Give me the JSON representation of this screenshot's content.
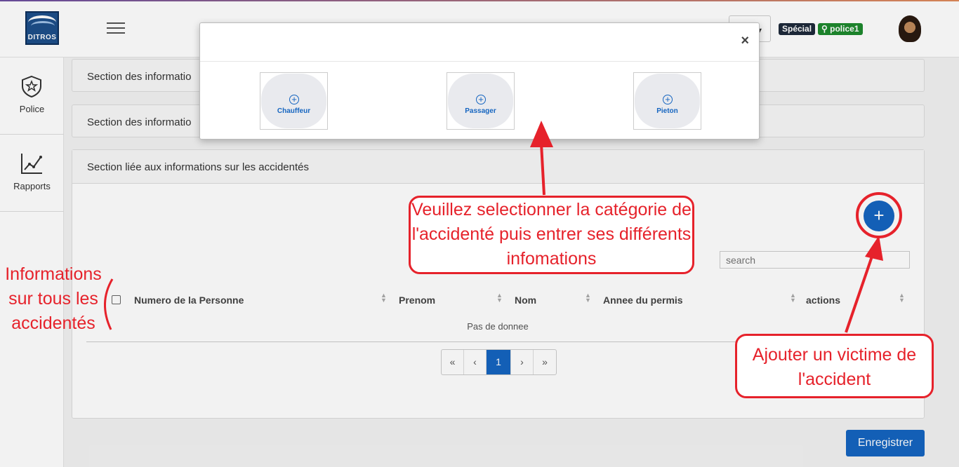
{
  "header": {
    "logo_text": "DITROS",
    "badge_role": "Spécial",
    "badge_user": "police1",
    "user_icon": "user-icon"
  },
  "sidebar": {
    "items": [
      {
        "label": "Police",
        "icon": "shield-star-icon"
      },
      {
        "label": "Rapports",
        "icon": "line-chart-icon"
      }
    ]
  },
  "panels": {
    "section1": "Section des informatio",
    "section2": "Section des informatio",
    "section3": "Section liée aux informations sur les accidentés"
  },
  "table": {
    "add_button": "+",
    "search_placeholder": "search",
    "columns": [
      "Numero de la Personne",
      "Prenom",
      "Nom",
      "Annee du permis",
      "actions"
    ],
    "empty_text": "Pas de donnee"
  },
  "pagination": {
    "first": "«",
    "prev": "‹",
    "current": "1",
    "next": "›",
    "last": "»"
  },
  "save_button": "Enregistrer",
  "modal": {
    "close": "×",
    "categories": [
      "Chauffeur",
      "Passager",
      "Pieton"
    ]
  },
  "annotations": {
    "select_category": "Veuillez selectionner la catégorie de l'accidenté puis entrer ses différents infomations",
    "add_victim": "Ajouter un victime de l'accident",
    "all_info": "Informations sur tous les accidentés"
  },
  "colors": {
    "primary": "#1565c0",
    "annotation": "#e6222b",
    "badge_green": "#1e8a2e",
    "badge_dark": "#1e2a3a"
  }
}
